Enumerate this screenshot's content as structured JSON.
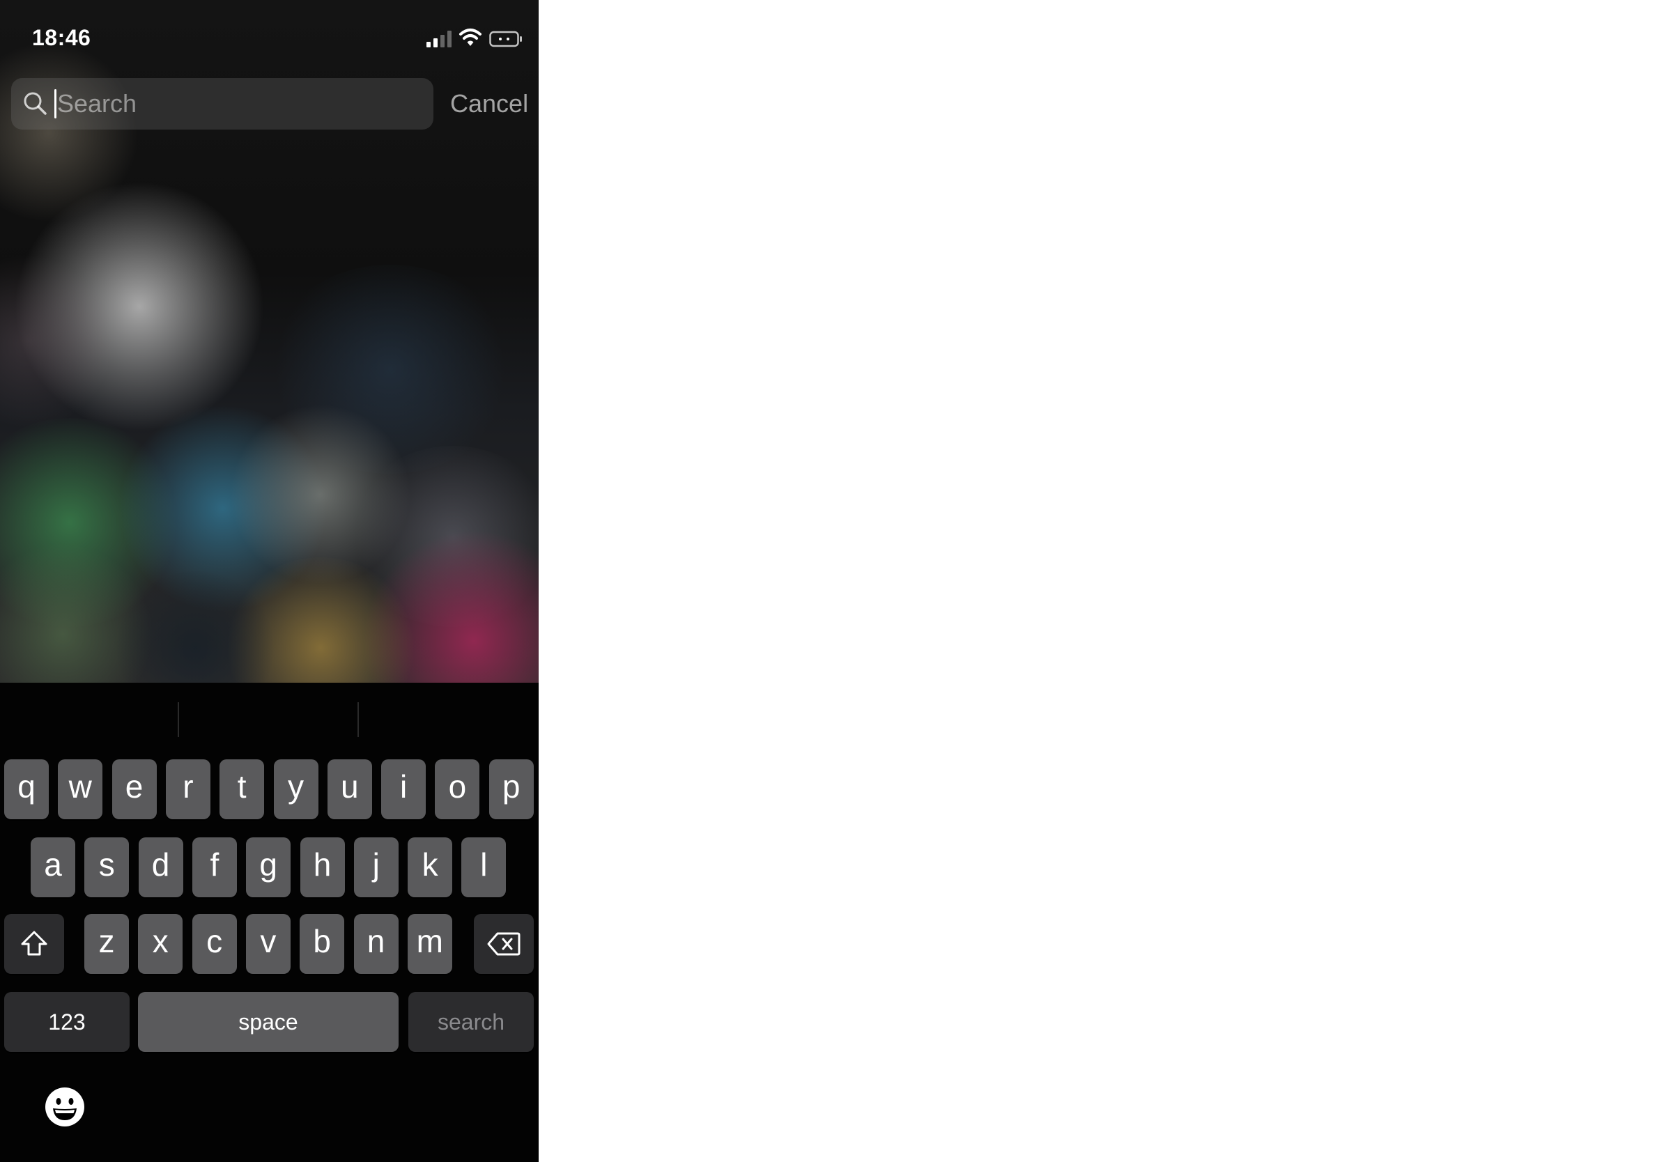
{
  "status_bar": {
    "time": "18:46",
    "signal_bars": 2,
    "signal_bars_total": 4
  },
  "search": {
    "placeholder": "Search",
    "value": "",
    "cancel_label": "Cancel"
  },
  "keyboard": {
    "rows": [
      [
        "q",
        "w",
        "e",
        "r",
        "t",
        "y",
        "u",
        "i",
        "o",
        "p"
      ],
      [
        "a",
        "s",
        "d",
        "f",
        "g",
        "h",
        "j",
        "k",
        "l"
      ],
      [
        "z",
        "x",
        "c",
        "v",
        "b",
        "n",
        "m"
      ]
    ],
    "numbers_label": "123",
    "space_label": "space",
    "return_label": "search"
  },
  "icons": {
    "search": "search-icon",
    "shift": "shift-icon",
    "delete": "delete-icon",
    "emoji": "emoji-icon",
    "wifi": "wifi-icon",
    "battery": "battery-icon",
    "signal": "signal-icon"
  },
  "colors": {
    "key": "#5a5a5c",
    "key_dark": "#2c2c2e",
    "keyboard_bg": "#030303",
    "search_field_bg": "rgba(120,120,120,0.28)"
  }
}
